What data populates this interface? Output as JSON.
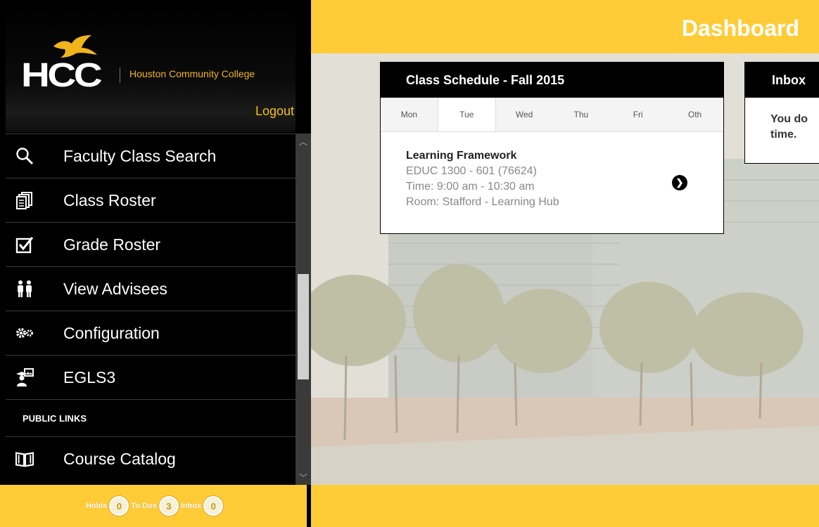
{
  "sidebar": {
    "logo_text": "HCC",
    "college_name": "Houston Community College",
    "logout": "Logout",
    "menu": [
      {
        "label": "Faculty Class Search",
        "icon": "search-icon"
      },
      {
        "label": "Class Roster",
        "icon": "roster-icon"
      },
      {
        "label": "Grade Roster",
        "icon": "checkbox-icon"
      },
      {
        "label": "View Advisees",
        "icon": "people-icon"
      },
      {
        "label": "Configuration",
        "icon": "gears-icon"
      },
      {
        "label": "EGLS3",
        "icon": "graduate-icon"
      }
    ],
    "section_header": "PUBLIC LINKS",
    "public_links": [
      {
        "label": "Course Catalog",
        "icon": "book-icon"
      }
    ]
  },
  "status_bar": {
    "holds_label": "Holds",
    "holds_count": "0",
    "todos_label": "To Dos",
    "todos_count": "3",
    "inbox_label": "Inbox",
    "inbox_count": "0"
  },
  "header": {
    "title": "Dashboard"
  },
  "schedule": {
    "title": "Class Schedule - Fall 2015",
    "days": [
      "Mon",
      "Tue",
      "Wed",
      "Thu",
      "Fri",
      "Oth"
    ],
    "active_day": "Tue",
    "class": {
      "name": "Learning Framework",
      "code": "EDUC 1300 - 601 (76624)",
      "time": "Time: 9:00 am - 10:30 am",
      "room": "Room: Stafford - Learning Hub"
    }
  },
  "inbox": {
    "title": "Inbox",
    "message_line1": "You do",
    "message_line2": "time."
  },
  "colors": {
    "accent": "#ffcc37",
    "sidebar_bg": "#000000",
    "logo_gold": "#f0b51d"
  }
}
